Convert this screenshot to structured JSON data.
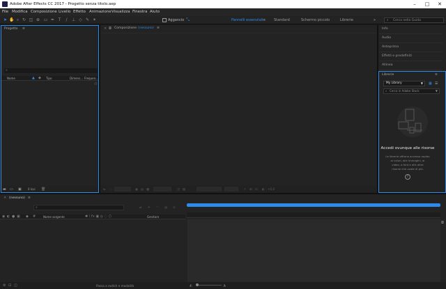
{
  "window": {
    "title": "Adobe After Effects CC 2017 - Progetto senza titolo.aep",
    "controls": [
      "minimize-icon",
      "maximize-icon",
      "close-icon"
    ]
  },
  "menu": [
    "File",
    "Modifica",
    "Composizione",
    "Livello",
    "Effetto",
    "Animazione",
    "Visualizza",
    "Finestra",
    "Aiuto"
  ],
  "toolbar": {
    "aggancio_label": "Aggancio",
    "workspaces": [
      {
        "label": "Pannelli essenziali",
        "active": true
      },
      {
        "label": "Standard",
        "active": false
      },
      {
        "label": "Schermo piccolo",
        "active": false
      },
      {
        "label": "Librerie",
        "active": false
      }
    ],
    "workspace_more": "»",
    "search_placeholder": "Cerca nella Guida"
  },
  "project_panel": {
    "title": "Progetto",
    "menu_icon": "≡",
    "columns": [
      "Nome",
      "Tipo",
      "Dimens...",
      "Frequen..."
    ],
    "bpc_label": "8 bpc"
  },
  "composition_panel": {
    "title_prefix": "Composizione",
    "title_value": "(nessuno)",
    "zoom_placeholder": "",
    "resolution_placeholder": "",
    "camera_label": "",
    "view_count": "",
    "exposure": "+0,0"
  },
  "right_panels": {
    "items": [
      "Info",
      "Audio",
      "Anteprima",
      "Effetti e predefiniti",
      "Allinea"
    ],
    "library": {
      "title": "Librerie",
      "selected": "My Library",
      "search_placeholder": "Cerca in Adobe Stock",
      "heading": "Accedi ovunque alle risorse",
      "body": [
        "Le librerie offrono accesso rapido",
        "ai colori, alle immagini, ai",
        "video, a font e alle altre",
        "risorse che usate di più."
      ],
      "help_icon": "?"
    }
  },
  "timeline": {
    "tab_label": "(nessuno)",
    "columns": [
      "Nome sorgente",
      "Genitore"
    ],
    "status_text": "Passa a switch e modalità"
  },
  "colors": {
    "accent": "#2d8ceb",
    "background": "#1b1b1b",
    "panel": "#232323",
    "titlebar": "#ffffff"
  }
}
